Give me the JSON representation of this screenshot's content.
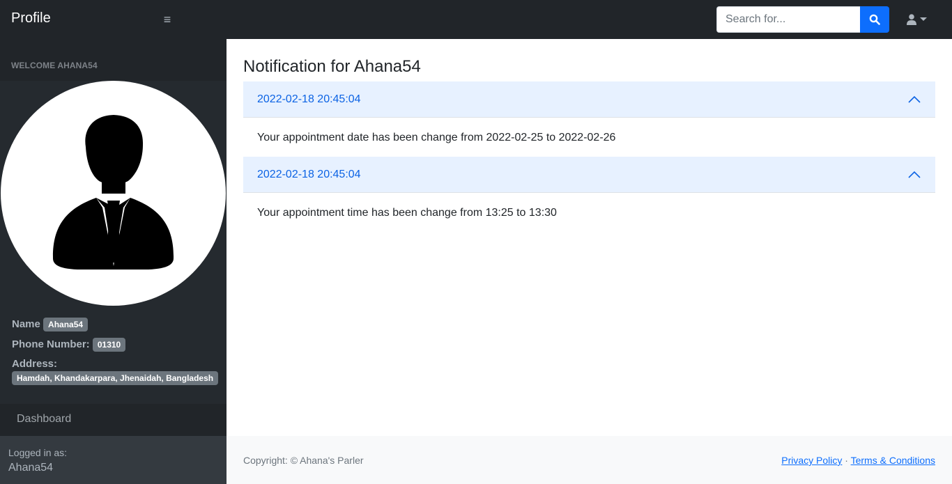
{
  "navbar": {
    "brand": "Profile",
    "menu_icon": "hamburger-icon",
    "search": {
      "placeholder": "Search for...",
      "value": "",
      "button_icon": "search-icon"
    },
    "user_menu_icon": "user-icon"
  },
  "sidebar": {
    "welcome": "WELCOME AHANA54",
    "avatar_icon": "businessman-avatar-icon",
    "name_label": "Name",
    "name_value": "Ahana54",
    "phone_label": "Phone Number:",
    "phone_value": "01310",
    "address_label": "Address:",
    "address_value": "Hamdah, Khandakarpara, Jhenaidah, Bangladesh",
    "nav_dashboard": "Dashboard",
    "logged_in_label": "Logged in as:",
    "logged_in_user": "Ahana54"
  },
  "main": {
    "title": "Notification for Ahana54",
    "notifications": [
      {
        "timestamp": "2022-02-18 20:45:04",
        "message": "Your appointment date has been change from 2022-02-25 to 2022-02-26"
      },
      {
        "timestamp": "2022-02-18 20:45:04",
        "message": "Your appointment time has been change from 13:25 to 13:30"
      }
    ]
  },
  "footer": {
    "copyright": "Copyright: © Ahana's Parler",
    "privacy_link": "Privacy Policy",
    "separator": "·",
    "terms_link": "Terms & Conditions"
  },
  "colors": {
    "navbar_bg": "#212529",
    "accent": "#0d6efd",
    "accordion_header_bg": "#e7f1ff",
    "accordion_header_text": "#0c63e4",
    "badge_bg": "#6c757d"
  }
}
